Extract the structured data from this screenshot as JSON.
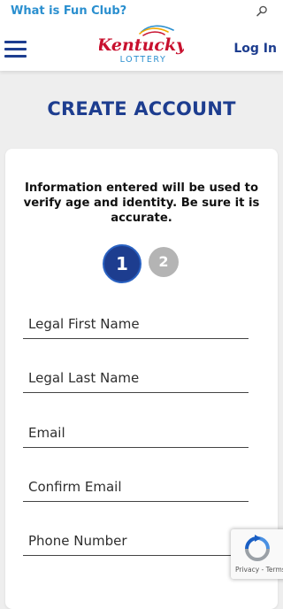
{
  "header": {
    "fun_club_link": "What is Fun Club?",
    "login_label": "Log In",
    "logo": {
      "line1": "Kentucky",
      "line2": "LOTTERY"
    },
    "icons": {
      "search": "search-icon",
      "menu": "hamburger-menu-icon"
    }
  },
  "page": {
    "title": "CREATE ACCOUNT",
    "info_text": "Information entered will be used to verify age and identity. Be sure it is accurate."
  },
  "steps": [
    {
      "label": "1",
      "state": "active"
    },
    {
      "label": "2",
      "state": "inactive"
    }
  ],
  "form": {
    "fields": [
      {
        "placeholder": "Legal First Name",
        "value": ""
      },
      {
        "placeholder": "Legal Last Name",
        "value": ""
      },
      {
        "placeholder": "Email",
        "value": ""
      },
      {
        "placeholder": "Confirm Email",
        "value": ""
      },
      {
        "placeholder": "Phone Number",
        "value": ""
      }
    ]
  },
  "recaptcha": {
    "links": "Privacy - Terms"
  },
  "colors": {
    "brand_blue": "#1d3d8f",
    "link_blue": "#2a8fcf",
    "logo_red": "#c8102e",
    "inactive_step": "#b4b4b4",
    "background": "#eeeeee"
  }
}
